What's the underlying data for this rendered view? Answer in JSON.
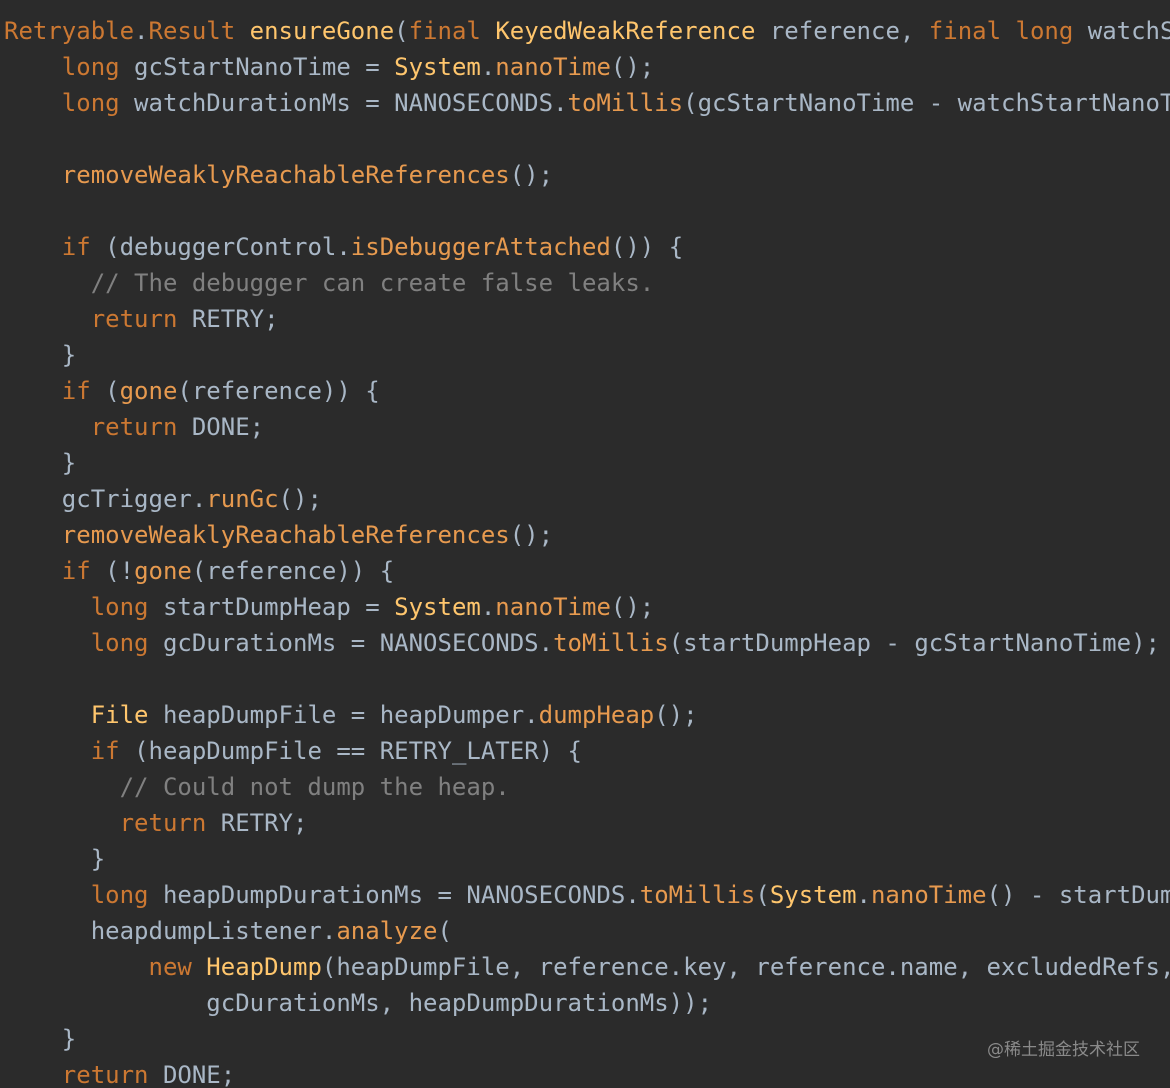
{
  "colors": {
    "background": "#2b2b2b",
    "plain": "#a9b7c6",
    "keyword": "#cc7832",
    "declaration": "#ffc66d",
    "method": "#e79a4f",
    "comment": "#808080"
  },
  "code_lines": [
    [
      [
        "kw",
        "Retryable"
      ],
      [
        "p",
        "."
      ],
      [
        "kw",
        "Result "
      ],
      [
        "fn",
        "ensureGone"
      ],
      [
        "p",
        "("
      ],
      [
        "kw",
        "final "
      ],
      [
        "cls",
        "KeyedWeakReference"
      ],
      [
        "p",
        " reference, "
      ],
      [
        "kw",
        "final "
      ],
      [
        "kw",
        "long "
      ],
      [
        "p",
        "watchS"
      ]
    ],
    [
      [
        "p",
        "    "
      ],
      [
        "kw",
        "long "
      ],
      [
        "p",
        "gcStartNanoTime = "
      ],
      [
        "cls",
        "System"
      ],
      [
        "p",
        "."
      ],
      [
        "m",
        "nanoTime"
      ],
      [
        "p",
        "();"
      ]
    ],
    [
      [
        "p",
        "    "
      ],
      [
        "kw",
        "long "
      ],
      [
        "p",
        "watchDurationMs = NANOSECONDS."
      ],
      [
        "m",
        "toMillis"
      ],
      [
        "p",
        "(gcStartNanoTime - watchStartNanoT"
      ]
    ],
    [],
    [
      [
        "p",
        "    "
      ],
      [
        "m",
        "removeWeaklyReachableReferences"
      ],
      [
        "p",
        "();"
      ]
    ],
    [],
    [
      [
        "p",
        "    "
      ],
      [
        "kw",
        "if "
      ],
      [
        "p",
        "(debuggerControl."
      ],
      [
        "m",
        "isDebuggerAttached"
      ],
      [
        "p",
        "()) {"
      ]
    ],
    [
      [
        "p",
        "      "
      ],
      [
        "cm",
        "// The debugger can create false leaks."
      ]
    ],
    [
      [
        "p",
        "      "
      ],
      [
        "kw",
        "return "
      ],
      [
        "p",
        "RETRY;"
      ]
    ],
    [
      [
        "p",
        "    }"
      ]
    ],
    [
      [
        "p",
        "    "
      ],
      [
        "kw",
        "if "
      ],
      [
        "p",
        "("
      ],
      [
        "m",
        "gone"
      ],
      [
        "p",
        "(reference)) {"
      ]
    ],
    [
      [
        "p",
        "      "
      ],
      [
        "kw",
        "return "
      ],
      [
        "p",
        "DONE;"
      ]
    ],
    [
      [
        "p",
        "    }"
      ]
    ],
    [
      [
        "p",
        "    gcTrigger."
      ],
      [
        "m",
        "runGc"
      ],
      [
        "p",
        "();"
      ]
    ],
    [
      [
        "p",
        "    "
      ],
      [
        "m",
        "removeWeaklyReachableReferences"
      ],
      [
        "p",
        "();"
      ]
    ],
    [
      [
        "p",
        "    "
      ],
      [
        "kw",
        "if "
      ],
      [
        "p",
        "(!"
      ],
      [
        "m",
        "gone"
      ],
      [
        "p",
        "(reference)) {"
      ]
    ],
    [
      [
        "p",
        "      "
      ],
      [
        "kw",
        "long "
      ],
      [
        "p",
        "startDumpHeap = "
      ],
      [
        "cls",
        "System"
      ],
      [
        "p",
        "."
      ],
      [
        "m",
        "nanoTime"
      ],
      [
        "p",
        "();"
      ]
    ],
    [
      [
        "p",
        "      "
      ],
      [
        "kw",
        "long "
      ],
      [
        "p",
        "gcDurationMs = NANOSECONDS."
      ],
      [
        "m",
        "toMillis"
      ],
      [
        "p",
        "(startDumpHeap - gcStartNanoTime);"
      ]
    ],
    [],
    [
      [
        "p",
        "      "
      ],
      [
        "cls",
        "File "
      ],
      [
        "p",
        "heapDumpFile = heapDumper."
      ],
      [
        "m",
        "dumpHeap"
      ],
      [
        "p",
        "();"
      ]
    ],
    [
      [
        "p",
        "      "
      ],
      [
        "kw",
        "if "
      ],
      [
        "p",
        "(heapDumpFile == RETRY_LATER) {"
      ]
    ],
    [
      [
        "p",
        "        "
      ],
      [
        "cm",
        "// Could not dump the heap."
      ]
    ],
    [
      [
        "p",
        "        "
      ],
      [
        "kw",
        "return "
      ],
      [
        "p",
        "RETRY;"
      ]
    ],
    [
      [
        "p",
        "      }"
      ]
    ],
    [
      [
        "p",
        "      "
      ],
      [
        "kw",
        "long "
      ],
      [
        "p",
        "heapDumpDurationMs = NANOSECONDS."
      ],
      [
        "m",
        "toMillis"
      ],
      [
        "p",
        "("
      ],
      [
        "cls",
        "System"
      ],
      [
        "p",
        "."
      ],
      [
        "m",
        "nanoTime"
      ],
      [
        "p",
        "() - startDum"
      ]
    ],
    [
      [
        "p",
        "      heapdumpListener."
      ],
      [
        "m",
        "analyze"
      ],
      [
        "p",
        "("
      ]
    ],
    [
      [
        "p",
        "          "
      ],
      [
        "kw",
        "new "
      ],
      [
        "cls",
        "HeapDump"
      ],
      [
        "p",
        "(heapDumpFile, reference.key, reference.name, excludedRefs,"
      ]
    ],
    [
      [
        "p",
        "              gcDurationMs, heapDumpDurationMs));"
      ]
    ],
    [
      [
        "p",
        "    }"
      ]
    ],
    [
      [
        "p",
        "    "
      ],
      [
        "kw",
        "return "
      ],
      [
        "p",
        "DONE;"
      ]
    ]
  ],
  "watermark": "@稀土掘金技术社区"
}
